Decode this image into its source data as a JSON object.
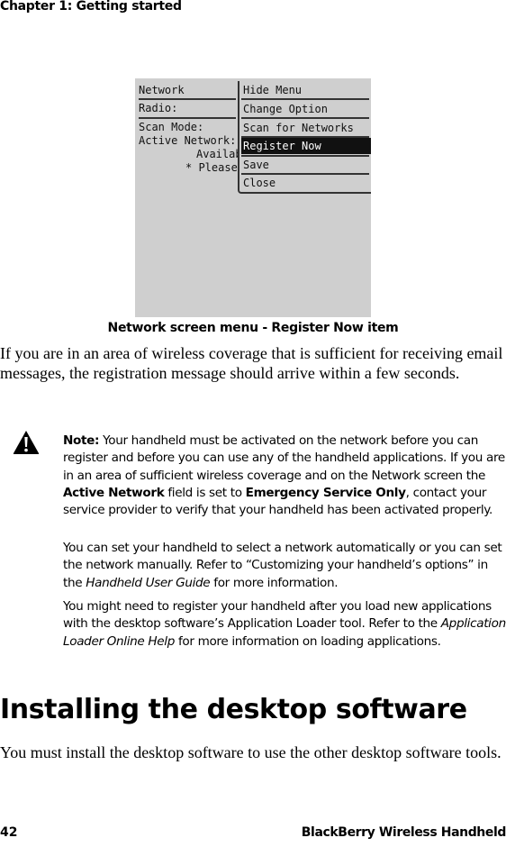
{
  "header": {
    "running_head": "Chapter 1: Getting started"
  },
  "figure": {
    "screen": {
      "left_fields": [
        "Network",
        "Radio:",
        "Scan Mode:",
        "Active Network:",
        "Availab",
        "* Please"
      ],
      "menu_items": [
        {
          "label": "Hide Menu",
          "selected": false
        },
        {
          "label": "Change Option",
          "selected": false
        },
        {
          "label": "Scan for Networks",
          "selected": false
        },
        {
          "label": "Register Now",
          "selected": true
        },
        {
          "label": "Save",
          "selected": false
        },
        {
          "label": "Close",
          "selected": false
        }
      ]
    },
    "caption": "Network screen menu - Register Now item"
  },
  "body": {
    "para1": "If you are in an area of wireless coverage that is sufficient for receiving email messages, the registration message should arrive within a few seconds."
  },
  "note": {
    "icon": "warning-icon",
    "p1": {
      "label": "Note:",
      "text_a": " Your handheld must be activated on the network before you can register and before you can use any of the handheld applications. If you are in an area of sufficient wireless coverage and on the Network screen the ",
      "bold_a": "Active Network",
      "text_b": " field is set to ",
      "bold_b": "Emergency Service Only",
      "text_c": ", contact your service provider to verify that your handheld has been activated properly."
    },
    "p2": {
      "text_a": "You can set your handheld to select a network automatically or you can set the network manually. Refer to “Customizing your handheld’s options” in the ",
      "italic": "Handheld User Guide",
      "text_b": " for more information."
    },
    "p3": {
      "text_a": "You might need to register your handheld after you load new applications with the desktop software’s Application Loader tool. Refer to the ",
      "italic": "Application Loader Online Help",
      "text_b": " for more information on loading applications."
    }
  },
  "section": {
    "heading": "Installing the desktop software",
    "para": "You must install the desktop software to use the other desktop software tools."
  },
  "footer": {
    "page_number": "42",
    "book_title": "BlackBerry Wireless Handheld"
  }
}
